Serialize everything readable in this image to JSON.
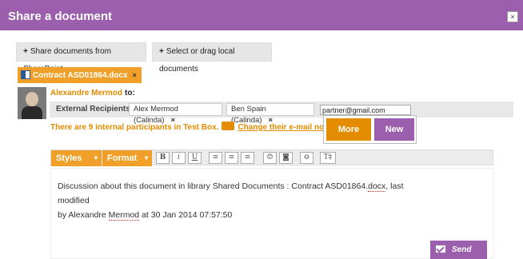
{
  "window": {
    "title": "Share a document",
    "close_label": "×"
  },
  "actions": {
    "share_sharepoint": "Share documents from SharePoint",
    "select_local": "Select or drag local documents",
    "plus": "+"
  },
  "document": {
    "name": "Contract ASD01864.docx",
    "remove": "×"
  },
  "sender": {
    "name": "Alexandre Mermod",
    "to": "to:"
  },
  "recipients": {
    "label": "External Recipients:",
    "chips": [
      {
        "name": "Alex Mermod (Calinda)",
        "remove": "×"
      },
      {
        "name": "Ben Spain (Calinda)",
        "remove": "×"
      }
    ],
    "input_value": "partner@gmail.com"
  },
  "info": {
    "internal_text": "There are 9 internal participants in Test Box.",
    "change_link": "Change their e-mail noti"
  },
  "popup": {
    "more": "More",
    "new": "New"
  },
  "toolbar": {
    "styles": "Styles",
    "format": "Format",
    "caret": "▾",
    "bold": "B",
    "italic": "i",
    "underline": "U",
    "align_left": "≡",
    "align_center": "≡",
    "align_right": "≡",
    "emoji": "☺",
    "image": "◙",
    "link": "⊖",
    "text_size": "T‡"
  },
  "editor": {
    "line1_prefix": "Discussion about this document in library Shared Documents : Contract ASD01864.",
    "line1_docx": "docx",
    "line1_suffix": ", last modified",
    "line2_prefix": "by Alexandre ",
    "line2_mermod": "Mermod",
    "line2_suffix": " at 30 Jan 2014 07:57:50"
  },
  "send": {
    "label": "Send"
  },
  "colors": {
    "brand_purple": "#9b5fae",
    "accent_orange": "#e48c00"
  }
}
